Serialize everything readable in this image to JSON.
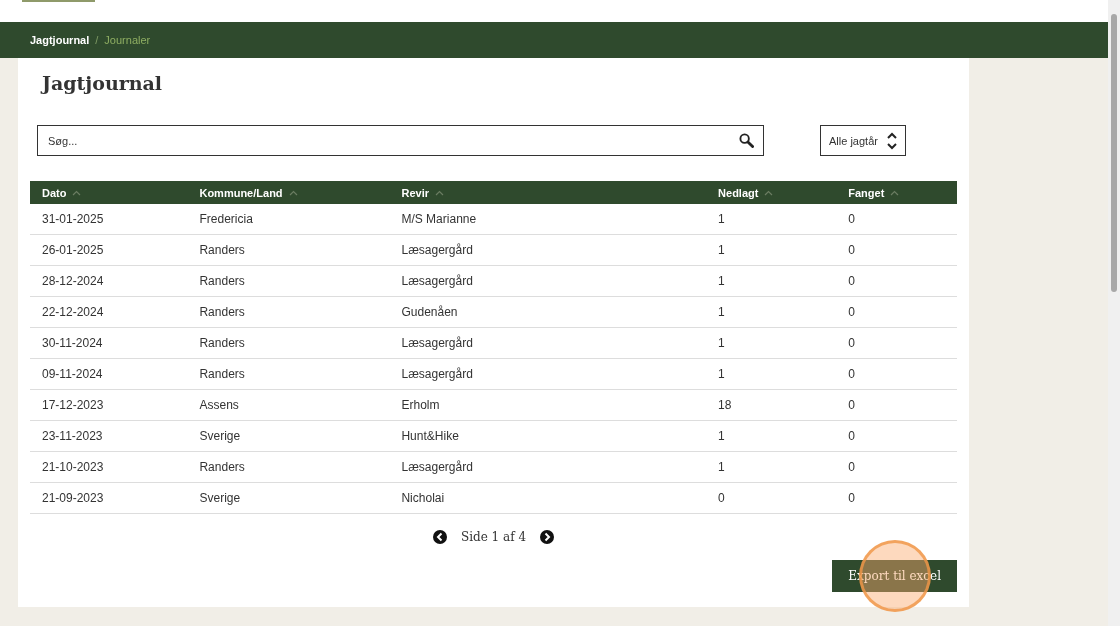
{
  "breadcrumb": [
    {
      "label": "Jagtjournal",
      "selected": false
    },
    {
      "label": "Journaler",
      "selected": true
    }
  ],
  "breadcrumb_separator": "/",
  "page_title": "Jagtjournal",
  "search": {
    "placeholder": "Søg..."
  },
  "year_select": {
    "value": "Alle jagtår"
  },
  "table": {
    "columns": [
      "Dato",
      "Kommune/Land",
      "Revir",
      "Nedlagt",
      "Fanget"
    ],
    "rows": [
      [
        "31-01-2025",
        "Fredericia",
        "M/S Marianne",
        "1",
        "0"
      ],
      [
        "26-01-2025",
        "Randers",
        "Læsagergård",
        "1",
        "0"
      ],
      [
        "28-12-2024",
        "Randers",
        "Læsagergård",
        "1",
        "0"
      ],
      [
        "22-12-2024",
        "Randers",
        "Gudenåen",
        "1",
        "0"
      ],
      [
        "30-11-2024",
        "Randers",
        "Læsagergård",
        "1",
        "0"
      ],
      [
        "09-11-2024",
        "Randers",
        "Læsagergård",
        "1",
        "0"
      ],
      [
        "17-12-2023",
        "Assens",
        "Erholm",
        "18",
        "0"
      ],
      [
        "23-11-2023",
        "Sverige",
        "Hunt&Hike",
        "1",
        "0"
      ],
      [
        "21-10-2023",
        "Randers",
        "Læsagergård",
        "1",
        "0"
      ],
      [
        "21-09-2023",
        "Sverige",
        "Nicholai",
        "0",
        "0"
      ]
    ]
  },
  "pagination": {
    "label": "Side 1 af 4"
  },
  "export_button": "Export til excel"
}
